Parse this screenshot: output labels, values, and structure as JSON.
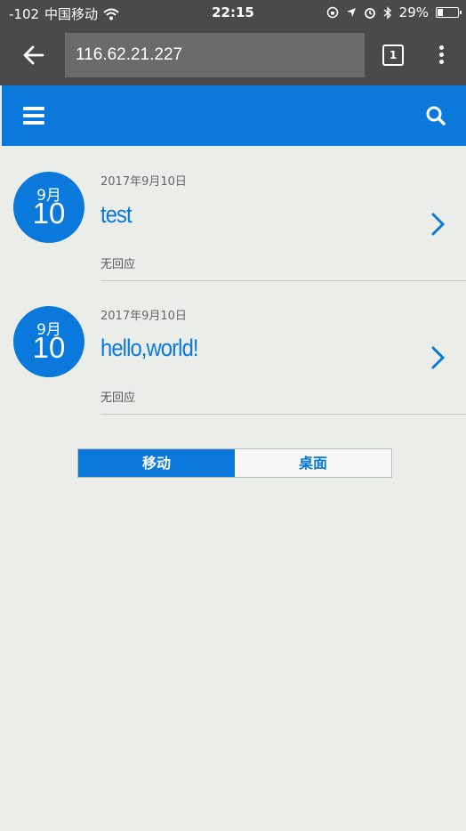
{
  "status_bar": {
    "signal": "-102",
    "carrier": "中国移动",
    "time": "22:15",
    "battery": "29%",
    "battery_level": 0.29
  },
  "browser": {
    "url": "116.62.21.227",
    "tab_count": "1"
  },
  "posts": [
    {
      "month": "9月",
      "day": "10",
      "date": "2017年9月10日",
      "title": "test",
      "replies": "无回应"
    },
    {
      "month": "9月",
      "day": "10",
      "date": "2017年9月10日",
      "title": "hello,world!",
      "replies": "无回应"
    }
  ],
  "view_toggle": {
    "mobile_label": "移动",
    "desktop_label": "桌面",
    "active": "mobile"
  },
  "colors": {
    "accent": "#0a79db",
    "browser_chrome": "#4a4a4a",
    "page_background": "#ebede9"
  }
}
